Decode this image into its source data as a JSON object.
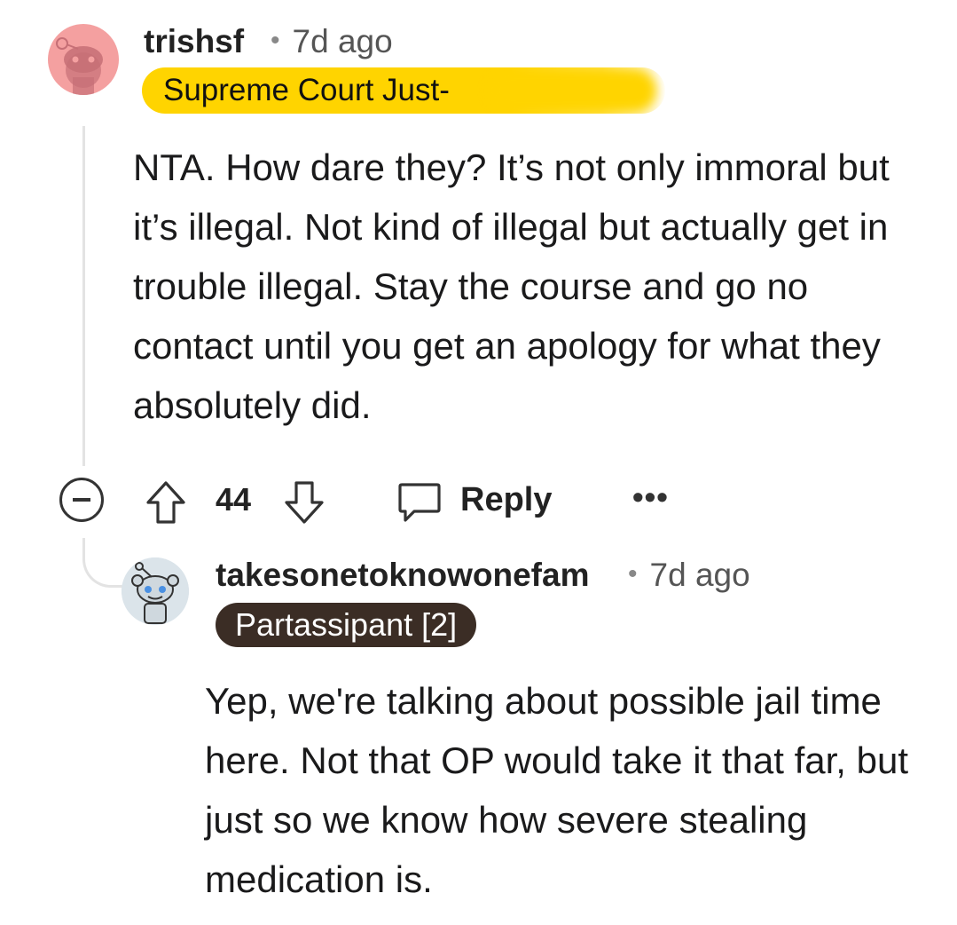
{
  "comment": {
    "username": "trishsf",
    "time": "7d ago",
    "flair": "Supreme Court Just-",
    "body": "NTA. How dare they? It’s not only immoral but it’s illegal. Not kind of illegal but actually get in trouble illegal. Stay the course and go no contact until you get an apology for what they absolutely did.",
    "avatar_icon": "snoo-avatar-icon",
    "flair_color": "#ffd400"
  },
  "actions": {
    "vote_count": "44",
    "reply_label": "Reply",
    "more_label": "•••",
    "collapse_icon": "minus-circle-icon",
    "upvote_icon": "arrow-up-icon",
    "downvote_icon": "arrow-down-icon",
    "reply_icon": "speech-bubble-icon"
  },
  "reply": {
    "username": "takesonetoknowonefam",
    "time": "7d ago",
    "flair": "Partassipant [2]",
    "flair_color": "#3b2d25",
    "body": "Yep, we're talking about possible jail time here. Not that OP would take it that far, but just so we know how severe stealing medication is.",
    "avatar_icon": "snoo-avatar-icon"
  }
}
